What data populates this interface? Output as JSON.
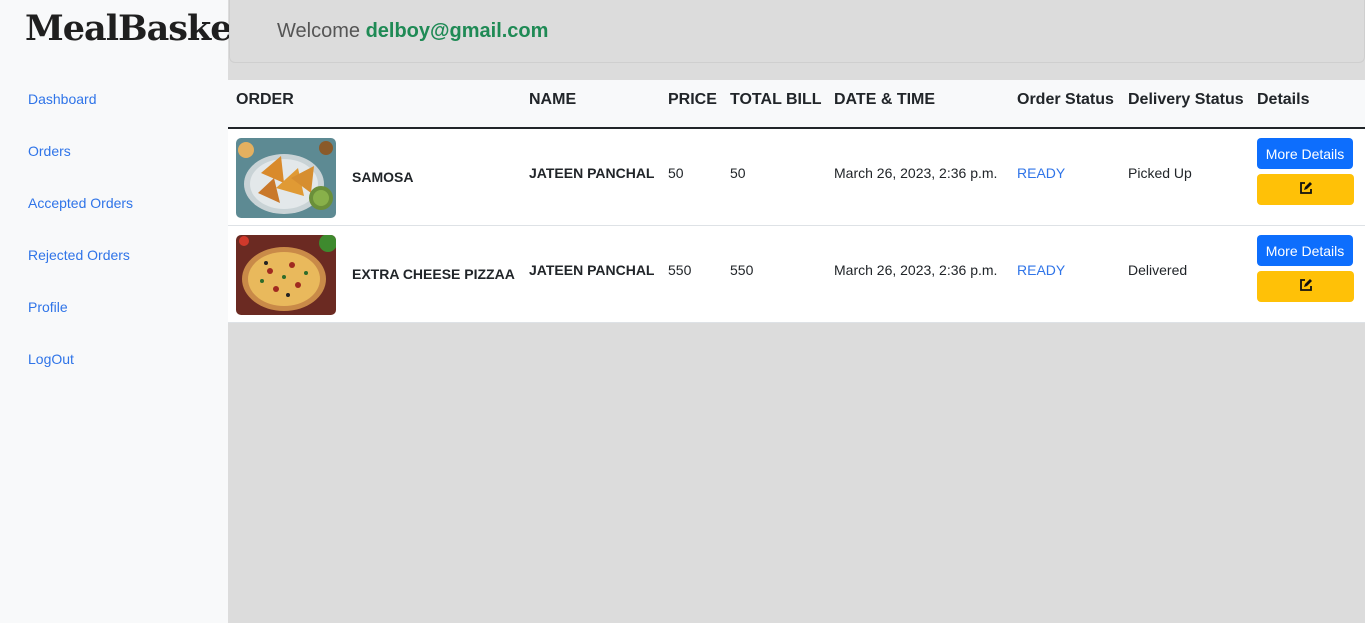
{
  "brand": "MealBasket",
  "header": {
    "welcome": "Welcome",
    "email": "delboy@gmail.com"
  },
  "sidebar": {
    "items": [
      {
        "label": "Dashboard"
      },
      {
        "label": "Orders"
      },
      {
        "label": "Accepted Orders"
      },
      {
        "label": "Rejected Orders"
      },
      {
        "label": "Profile"
      },
      {
        "label": "LogOut"
      }
    ]
  },
  "table": {
    "headers": {
      "order": "ORDER",
      "name": "NAME",
      "price": "PRICE",
      "total": "TOTAL BILL",
      "datetime": "DATE & TIME",
      "order_status": "Order Status",
      "delivery_status": "Delivery Status",
      "details": "Details"
    },
    "rows": [
      {
        "item": "SAMOSA",
        "name": "JATEEN PANCHAL",
        "price": "50",
        "total": "50",
        "datetime": "March 26, 2023, 2:36 p.m.",
        "order_status": "READY",
        "delivery_status": "Picked Up",
        "details_label": "More Details",
        "image_icon": "samosa-image"
      },
      {
        "item": "EXTRA CHEESE PIZZAA",
        "name": "JATEEN PANCHAL",
        "price": "550",
        "total": "550",
        "datetime": "March 26, 2023, 2:36 p.m.",
        "order_status": "READY",
        "delivery_status": "Delivered",
        "details_label": "More Details",
        "image_icon": "pizza-image"
      }
    ]
  },
  "colors": {
    "accent": "#0d6efd",
    "warning": "#ffc107",
    "email": "#1f8a55",
    "link": "#2f74e8"
  }
}
